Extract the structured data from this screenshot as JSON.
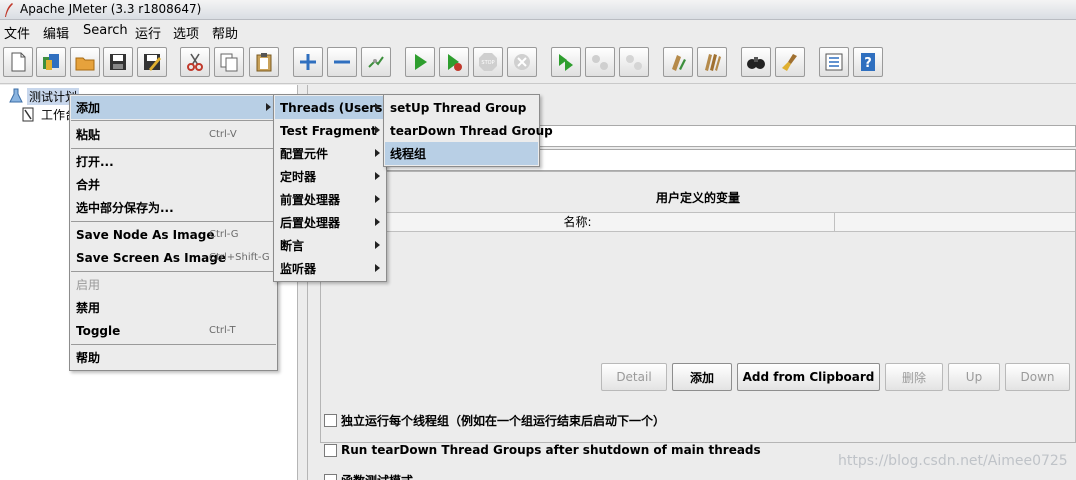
{
  "window": {
    "title": "Apache JMeter (3.3 r1808647)"
  },
  "menubar": [
    "文件",
    "编辑",
    "Search",
    "运行",
    "选项",
    "帮助"
  ],
  "tree": {
    "items": [
      "测试计划",
      "工作台"
    ]
  },
  "context_menu": {
    "items": [
      {
        "label": "添加",
        "accel": ""
      },
      {
        "label": "粘贴",
        "accel": "Ctrl-V"
      },
      {
        "label": "打开...",
        "accel": ""
      },
      {
        "label": "合并",
        "accel": ""
      },
      {
        "label": "选中部分保存为...",
        "accel": ""
      },
      {
        "label": "Save Node As Image",
        "accel": "Ctrl-G"
      },
      {
        "label": "Save Screen As Image",
        "accel": "Ctrl+Shift-G"
      },
      {
        "label": "启用",
        "accel": ""
      },
      {
        "label": "禁用",
        "accel": ""
      },
      {
        "label": "Toggle",
        "accel": "Ctrl-T"
      },
      {
        "label": "帮助",
        "accel": ""
      }
    ]
  },
  "add_submenu": [
    "Threads (Users)",
    "Test Fragment",
    "配置元件",
    "定时器",
    "前置处理器",
    "后置处理器",
    "断言",
    "监听器"
  ],
  "threads_submenu": [
    "setUp Thread Group",
    "tearDown Thread Group",
    "线程组"
  ],
  "variables": {
    "title": "用户定义的变量",
    "col_name": "名称:"
  },
  "buttons": {
    "detail": "Detail",
    "add": "添加",
    "add_clipboard": "Add from Clipboard",
    "delete": "删除",
    "up": "Up",
    "down": "Down"
  },
  "checkboxes": [
    "独立运行每个线程组（例如在一个组运行结束后启动下一个）",
    "Run tearDown Thread Groups after shutdown of main threads",
    "函数测试模式"
  ],
  "watermark": "https://blog.csdn.net/Aimee0725",
  "toolbar_icons": [
    "new-icon",
    "templates-icon",
    "open-icon",
    "save-icon",
    "save-as-icon",
    "cut-icon",
    "copy-icon",
    "paste-icon",
    "expand-icon",
    "collapse-icon",
    "toggle-icon",
    "start-icon",
    "start-no-pause-icon",
    "stop-icon",
    "shutdown-icon",
    "remote-start-icon",
    "remote-stop-icon",
    "remote-shutdown-icon",
    "clear-icon",
    "clear-all-icon",
    "search-icon",
    "reset-search-icon",
    "function-helper-icon",
    "help-icon"
  ]
}
